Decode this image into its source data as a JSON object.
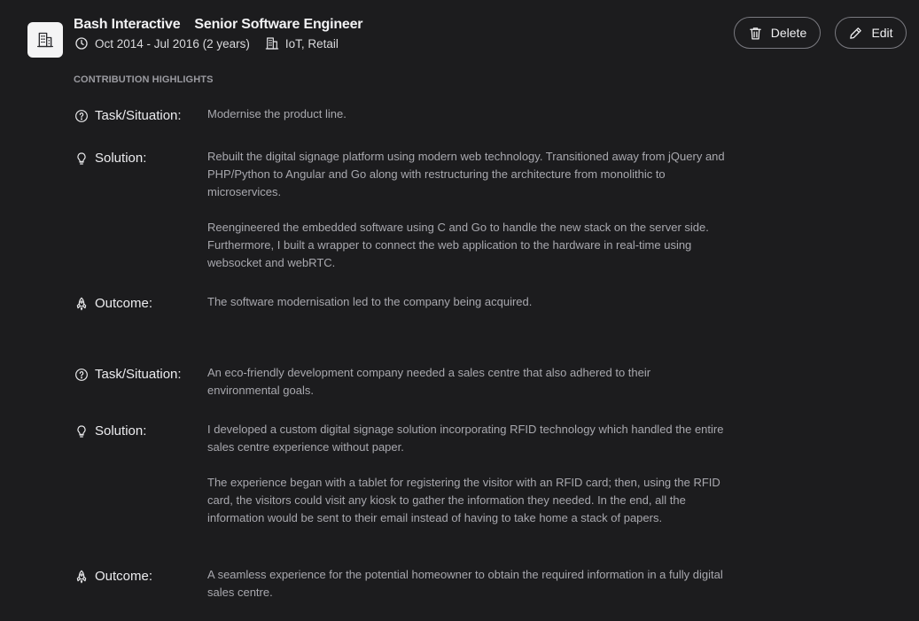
{
  "header": {
    "company": "Bash Interactive",
    "role": "Senior Software Engineer",
    "duration": "Oct 2014 - Jul 2016 (2 years)",
    "industries": "IoT, Retail"
  },
  "actions": {
    "delete_label": "Delete",
    "edit_label": "Edit"
  },
  "section_title": "CONTRIBUTION HIGHLIGHTS",
  "labels": {
    "task": "Task/Situation:",
    "solution": "Solution:",
    "outcome": "Outcome:"
  },
  "highlights": [
    {
      "task": "Modernise the product line.",
      "solution": [
        "Rebuilt the digital signage platform using modern web technology. Transitioned away from jQuery and PHP/Python to Angular and Go along with restructuring the architecture from monolithic to microservices.",
        "Reengineered the embedded software using C and Go to handle the new stack on the server side. Furthermore, I built a wrapper to connect the web application to the hardware in real-time using websocket and webRTC."
      ],
      "outcome": "The software modernisation led to the company being acquired."
    },
    {
      "task": "An eco-friendly development company needed a sales centre that also adhered to their environmental goals.",
      "solution": [
        "I developed a custom digital signage solution incorporating RFID technology which handled the entire sales centre experience without paper.",
        "The experience began with a tablet for registering the visitor with an RFID card; then, using the RFID card, the visitors could visit any kiosk to gather the information they needed. In the end, all the information would be sent to their email instead of having to take home a stack of papers."
      ],
      "outcome": "A seamless experience for the potential homeowner to obtain the required information in a fully digital sales centre."
    }
  ],
  "icons": {
    "logo": "building-icon",
    "duration": "clock-icon",
    "industries": "office-building-icon",
    "delete": "trash-icon",
    "edit": "pencil-icon",
    "task": "question-circle-icon",
    "solution": "lightbulb-icon",
    "outcome": "rocket-icon"
  },
  "colors": {
    "background": "#1c1c1e",
    "text_primary": "#ececef",
    "text_secondary": "#a8a8ae",
    "section_label": "#9a9aa0",
    "button_border": "#7a7a80"
  }
}
